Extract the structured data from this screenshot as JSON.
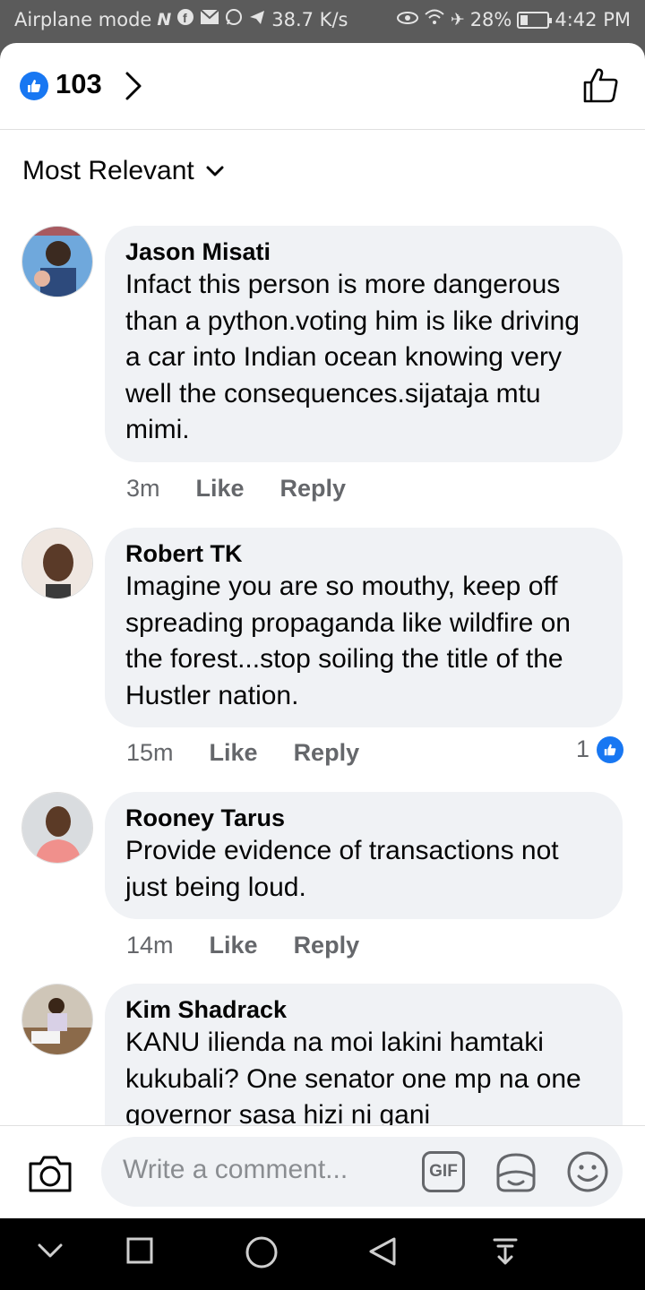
{
  "status_bar": {
    "mode": "Airplane mode",
    "speed": "38.7 K/s",
    "battery": "28%",
    "battery_level": 0.28,
    "time": "4:42 PM"
  },
  "header": {
    "reaction_count": "103",
    "icons": [
      "like-reaction-icon",
      "chevron-right-icon",
      "thumbs-up-outline-icon"
    ]
  },
  "sort": {
    "label": "Most Relevant"
  },
  "comments": [
    {
      "author": "Jason Misati",
      "text": "Infact this  person is more dangerous than a python.voting him is like driving a car into Indian ocean  knowing very well the consequences.sijataja mtu mimi.",
      "time": "3m",
      "like": "Like",
      "reply": "Reply"
    },
    {
      "author": "Robert TK",
      "text": "Imagine you are so mouthy, keep off spreading propaganda like wildfire on the forest...stop soiling the title of the Hustler nation.",
      "time": "15m",
      "like": "Like",
      "reply": "Reply",
      "reactions": "1"
    },
    {
      "author": "Rooney Tarus",
      "text": "Provide evidence of transactions not just being loud.",
      "time": "14m",
      "like": "Like",
      "reply": "Reply"
    },
    {
      "author": "Kim Shadrack",
      "text": "KANU ilienda na moi lakini hamtaki kukubali? One senator one mp na one governor  sasa hizi ni gani",
      "time": "",
      "like": "",
      "reply": ""
    }
  ],
  "composer": {
    "placeholder": "Write a comment...",
    "gif_label": "GIF",
    "icons": [
      "camera-icon",
      "sticker-icon",
      "emoji-icon"
    ]
  },
  "nav": {
    "icons": [
      "nav-hide-icon",
      "recents-icon",
      "home-icon",
      "back-icon",
      "notification-pull-icon"
    ]
  },
  "colors": {
    "accent": "#1877f2",
    "bubble": "#f0f2f5",
    "meta": "#65676b",
    "status_bg": "#5b5b5b"
  }
}
